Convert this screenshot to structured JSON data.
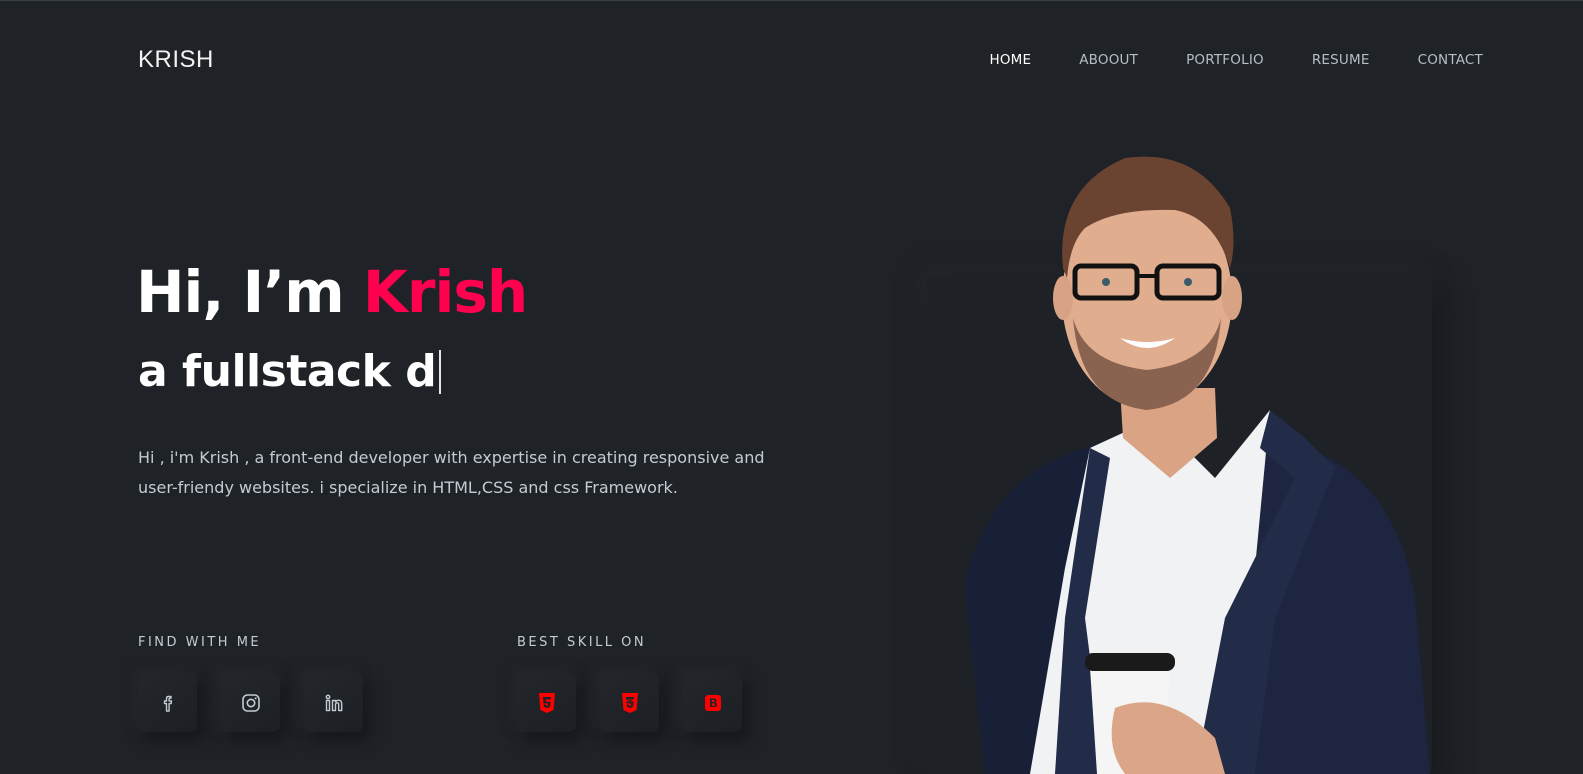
{
  "header": {
    "logo": "KRISH",
    "nav": [
      {
        "label": "HOME",
        "active": true
      },
      {
        "label": "ABOOUT",
        "active": false
      },
      {
        "label": "PORTFOLIO",
        "active": false
      },
      {
        "label": "RESUME",
        "active": false
      },
      {
        "label": "CONTACT",
        "active": false
      }
    ]
  },
  "hero": {
    "greeting_prefix": "Hi, I’m",
    "name": "Krish",
    "role_typed": "a fullstack d",
    "description": "Hi , i'm Krish , a front-end developer with expertise in creating responsive and user-friendy websites. i specialize in HTML,CSS and css Framework."
  },
  "find": {
    "title": "FIND WITH ME",
    "icons": [
      "facebook-icon",
      "instagram-icon",
      "linkedin-icon"
    ]
  },
  "skills": {
    "title": "BEST SKILL ON",
    "icons": [
      "html5-icon",
      "css3-icon",
      "bootstrap-icon"
    ]
  },
  "colors": {
    "background": "#1f2226",
    "accent": "#ff014f",
    "text": "#c4cbd3",
    "skill_icon": "#ff0000"
  }
}
